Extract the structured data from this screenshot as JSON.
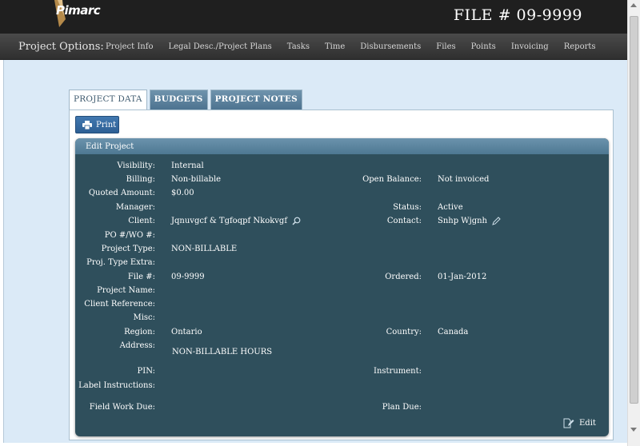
{
  "header": {
    "logo_text": "Pimarc",
    "file_title": "FILE # 09-9999"
  },
  "nav": {
    "label": "Project Options:",
    "items": [
      "Project Info",
      "Legal Desc./Project Plans",
      "Tasks",
      "Time",
      "Disbursements",
      "Files",
      "Points",
      "Invoicing",
      "Reports"
    ]
  },
  "tabs": {
    "project_data": "PROJECT DATA",
    "budgets": "BUDGETS",
    "project_notes": "PROJECT NOTES"
  },
  "print_button": {
    "label": "Print"
  },
  "edit_project": {
    "header": "Edit Project",
    "left": {
      "visibility_label": "Visibility:",
      "visibility_value": "Internal",
      "billing_label": "Billing:",
      "billing_value": "Non-billable",
      "quoted_amount_label": "Quoted Amount:",
      "quoted_amount_value": "$0.00",
      "manager_label": "Manager:",
      "manager_value": "",
      "client_label": "Client:",
      "client_value": "Jqnuvgcf & Tgfoqpf Nkokvgf",
      "po_wo_label": "PO #/WO #:",
      "po_wo_value": "",
      "project_type_label": "Project Type:",
      "project_type_value": "NON-BILLABLE",
      "proj_type_extra_label": "Proj. Type Extra:",
      "proj_type_extra_value": "",
      "file_no_label": "File #:",
      "file_no_value": "09-9999",
      "project_name_label": "Project Name:",
      "project_name_value": "",
      "client_reference_label": "Client Reference:",
      "client_reference_value": "",
      "misc_label": "Misc:",
      "misc_value": "",
      "region_label": "Region:",
      "region_value": "Ontario",
      "address_label": "Address:",
      "address_value": "NON-BILLABLE HOURS",
      "pin_label": "PIN:",
      "pin_value": "",
      "label_instructions_label": "Label Instructions:",
      "label_instructions_value": "",
      "field_work_due_label": "Field Work Due:",
      "field_work_due_value": ""
    },
    "right": {
      "open_balance_label": "Open Balance:",
      "open_balance_value": "Not invoiced",
      "status_label": "Status:",
      "status_value": "Active",
      "contact_label": "Contact:",
      "contact_value": "Snhp Wjgnh",
      "ordered_label": "Ordered:",
      "ordered_value": "01-Jan-2012",
      "country_label": "Country:",
      "country_value": "Canada",
      "instrument_label": "Instrument:",
      "instrument_value": "",
      "plan_due_label": "Plan Due:",
      "plan_due_value": ""
    },
    "edit_link": "Edit"
  },
  "icons": {
    "client_lookup": "search-icon",
    "contact_edit": "pencil-icon",
    "print": "printer-icon",
    "edit": "edit-icon"
  },
  "colors": {
    "topbar": "#1f1f1f",
    "content_bg": "#dbeaf7",
    "edit_box": "#2f4f5c",
    "tab_active_text": "#3e5a6e",
    "print_button": "#2d5f94"
  }
}
